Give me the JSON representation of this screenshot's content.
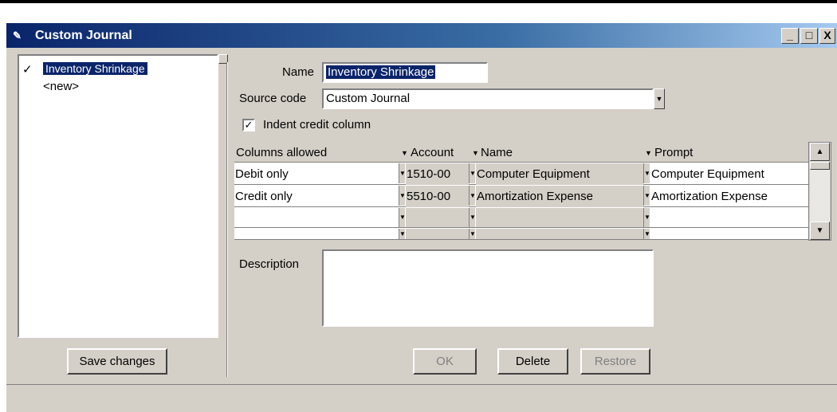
{
  "window": {
    "title": "Custom Journal",
    "icon": "app-icon",
    "controls": {
      "minimize": "_",
      "maximize": "□",
      "close": "X"
    }
  },
  "journal_list": {
    "items": [
      {
        "label": "Inventory Shrinkage",
        "checked": true,
        "selected": true
      },
      {
        "label": "<new>",
        "checked": false,
        "selected": false
      }
    ],
    "check_mark": "✓"
  },
  "buttons": {
    "save_changes": "Save changes",
    "ok": "OK",
    "delete": "Delete",
    "restore": "Restore"
  },
  "form": {
    "name_label": "Name",
    "name_value": "Inventory Shrinkage",
    "source_code_label": "Source code",
    "source_code_value": "Custom Journal",
    "indent_credit_label": "Indent credit column",
    "indent_credit_checked": true,
    "description_label": "Description",
    "description_value": ""
  },
  "grid": {
    "headers": {
      "columns_allowed": "Columns allowed",
      "account": "Account",
      "name": "Name",
      "prompt": "Prompt"
    },
    "rows": [
      {
        "columns_allowed": "Debit only",
        "account": "1510-00",
        "name": "Computer Equipment",
        "prompt": "Computer Equipment"
      },
      {
        "columns_allowed": "Credit only",
        "account": "5510-00",
        "name": "Amortization Expense",
        "prompt": "Amortization Expense"
      },
      {
        "columns_allowed": "",
        "account": "",
        "name": "",
        "prompt": ""
      },
      {
        "columns_allowed": "",
        "account": "",
        "name": "",
        "prompt": ""
      }
    ]
  },
  "colors": {
    "title_bar": "#0a246a",
    "window_face": "#d4d0c8",
    "selection": "#0a246a"
  }
}
